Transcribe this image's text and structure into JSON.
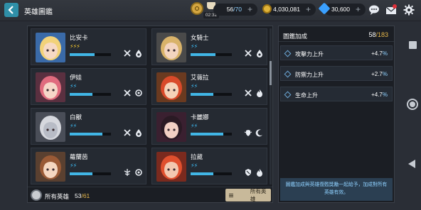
{
  "header": {
    "title": "英雄圖鑑",
    "stamina": {
      "value": "56",
      "max": "/70",
      "timer": "02:32"
    },
    "coins": {
      "value": "4,030,081"
    },
    "gems": {
      "value": "30,600"
    },
    "plus": "+"
  },
  "heroes": [
    {
      "name": "比安卡",
      "stars": "⚡⚡⚡",
      "star_color": "yellow",
      "progress": 0.6,
      "icons": [
        "crossed-swords-icon",
        "water-drop-icon"
      ],
      "palette": {
        "bg": "#3a6aa8",
        "hair": "#f2d27a",
        "skin": "#f6d9c4"
      }
    },
    {
      "name": "女騎士",
      "stars": "⚡⚡",
      "star_color": "blue",
      "progress": 0.6,
      "icons": [
        "crossed-swords-icon",
        "water-drop-icon"
      ],
      "palette": {
        "bg": "#4a4a4a",
        "hair": "#d9b36a",
        "skin": "#f3d4bf"
      }
    },
    {
      "name": "伊娃",
      "stars": "⚡⚡",
      "star_color": "blue",
      "progress": 0.55,
      "icons": [
        "crossed-swords-icon",
        "gear-element-icon"
      ],
      "palette": {
        "bg": "#5a3040",
        "hair": "#e06b7e",
        "skin": "#f6d6c8"
      }
    },
    {
      "name": "艾薇拉",
      "stars": "⚡⚡",
      "star_color": "blue",
      "progress": 0.55,
      "icons": [
        "crossed-swords-icon",
        "fire-icon"
      ],
      "palette": {
        "bg": "#6a3a20",
        "hair": "#d94a2a",
        "skin": "#f5d2b8"
      }
    },
    {
      "name": "白獸",
      "stars": "⚡⚡",
      "star_color": "blue",
      "progress": 0.8,
      "icons": [
        "crossed-swords-icon",
        "water-drop-icon"
      ],
      "palette": {
        "bg": "#4a4e58",
        "hair": "#d6d8de",
        "skin": "#b8bcc6"
      }
    },
    {
      "name": "卡麗娜",
      "stars": "⚡⚡",
      "star_color": "blue",
      "progress": 0.8,
      "icons": [
        "shield-wings-icon",
        "moon-icon"
      ],
      "palette": {
        "bg": "#3a2030",
        "hair": "#2a1a24",
        "skin": "#f2d0c4"
      }
    },
    {
      "name": "蘿蘭茵",
      "stars": "⚡⚡",
      "star_color": "blue",
      "progress": 0.55,
      "icons": [
        "wing-staff-icon",
        "gear-element-icon"
      ],
      "palette": {
        "bg": "#5a4030",
        "hair": "#9a5a36",
        "skin": "#f5d6c0"
      }
    },
    {
      "name": "拉葳",
      "stars": "⚡⚡",
      "star_color": "blue",
      "progress": 0.55,
      "icons": [
        "shield-icon",
        "fire-icon"
      ],
      "palette": {
        "bg": "#7a2a1e",
        "hair": "#e0502e",
        "skin": "#f2c8b0"
      }
    }
  ],
  "footer": {
    "all_heroes_label": "所有英雄",
    "count": "53",
    "max": "/61",
    "filter_label": "所有英雄"
  },
  "collection": {
    "title": "圖鑑加成",
    "count": "58",
    "max": "/183",
    "stats": [
      {
        "label": "攻擊力上升",
        "value": "+4.7",
        "pct": "%"
      },
      {
        "label": "防禦力上升",
        "value": "+2.7",
        "pct": "%"
      },
      {
        "label": "生命上升",
        "value": "+4.7",
        "pct": "%"
      }
    ],
    "note": "圖鑑加成與英雄復甦獎勵一起給予，加成對所有英雄有效。"
  }
}
